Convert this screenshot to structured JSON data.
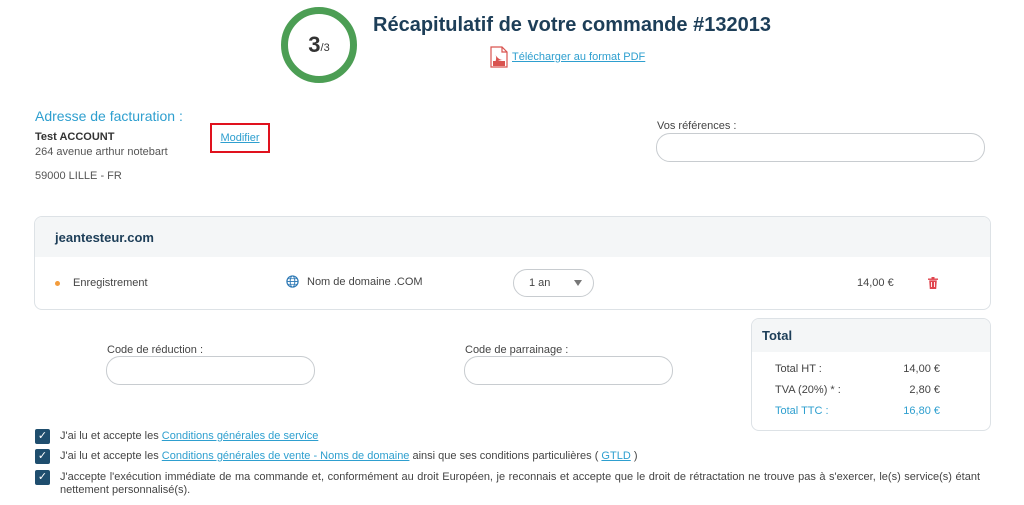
{
  "header": {
    "step_current": "3",
    "step_total": "/3",
    "title": "Récapitulatif de votre commande #132013",
    "pdf_link": "Télécharger au format PDF"
  },
  "billing": {
    "title": "Adresse de facturation :",
    "name": "Test ACCOUNT",
    "street": "264 avenue arthur notebart",
    "city": "59000 LILLE - FR",
    "modify_link": "Modifier"
  },
  "references": {
    "label": "Vos références :",
    "value": "",
    "placeholder": ""
  },
  "order": {
    "domain": "jeantesteur.com",
    "items": [
      {
        "operation": "Enregistrement",
        "product": "Nom de domaine .COM",
        "duration": "1 an",
        "price": "14,00 €"
      }
    ]
  },
  "codes": {
    "discount_label": "Code de réduction :",
    "discount_value": "",
    "referral_label": "Code de parrainage :",
    "referral_value": ""
  },
  "total": {
    "title": "Total",
    "ht_label": "Total HT :",
    "ht_value": "14,00 €",
    "tva_label": "TVA (20%) * :",
    "tva_value": "2,80 €",
    "ttc_label": "Total TTC :",
    "ttc_value": "16,80 €"
  },
  "agreements": {
    "service_prefix": "J'ai lu et accepte les ",
    "service_link": "Conditions générales de service",
    "sales_prefix": "J'ai lu et accepte les ",
    "sales_link": "Conditions générales de vente - Noms de domaine",
    "sales_middle": " ainsi que ses conditions particulières ( ",
    "gtld_link": "GTLD",
    "sales_suffix": " )",
    "execution_text": "J'accepte l'exécution immédiate de ma commande et, conformément au droit Européen, je reconnais et accepte que le droit de rétractation ne trouve pas à s'exercer, le(s) service(s) étant nettement personnalisé(s)."
  },
  "colors": {
    "progress_ring": "#4c9e54",
    "title": "#1d3e58",
    "link": "#2e9fcf",
    "highlight_box": "#e0121e",
    "checkbox": "#1f4e6e",
    "delete_icon": "#e0444e"
  }
}
